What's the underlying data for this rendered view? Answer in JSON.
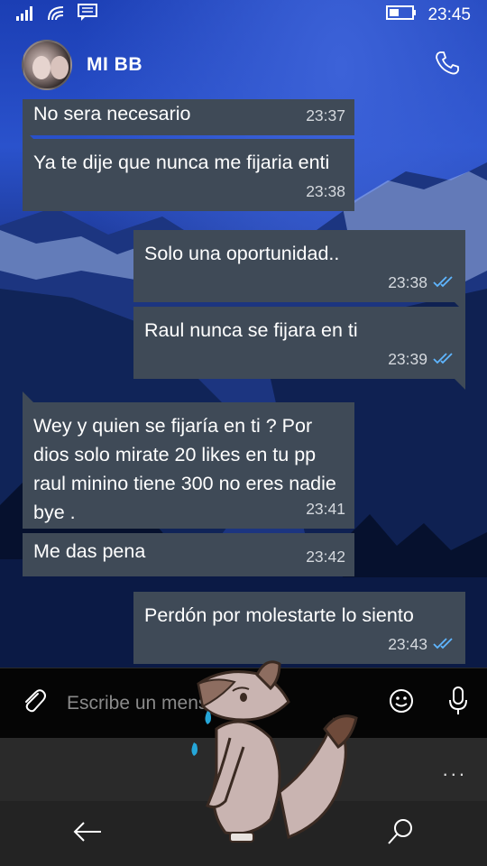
{
  "status_bar": {
    "time": "23:45",
    "icons": [
      "signal-icon",
      "wifi-icon",
      "message-notification-icon",
      "battery-icon"
    ]
  },
  "header": {
    "contact_name": "MI BB",
    "avatar": "avatar",
    "call_icon": "phone-icon"
  },
  "messages": [
    {
      "direction": "in",
      "text": "No sera necesario",
      "time": "23:37"
    },
    {
      "direction": "in",
      "text": "Ya te dije que nunca me fijaria enti",
      "time": "23:38"
    },
    {
      "direction": "out",
      "text": "Solo una oportunidad..",
      "time": "23:38",
      "read": true
    },
    {
      "direction": "out",
      "text": "Raul nunca se fijara en ti",
      "time": "23:39",
      "read": true
    },
    {
      "direction": "in",
      "text": "Wey y quien se fijaría en ti ? Por dios solo mirate 20 likes en tu pp raul minino tiene 300 no eres nadie bye .",
      "time": "23:41"
    },
    {
      "direction": "in",
      "text": "Me das pena",
      "time": "23:42"
    },
    {
      "direction": "out",
      "text": "Perdón por molestarte lo siento",
      "time": "23:43",
      "read": true
    }
  ],
  "input_bar": {
    "placeholder": "Escribe un mensaje",
    "icons": [
      "paperclip-icon",
      "emoji-icon",
      "microphone-icon"
    ]
  },
  "app_bar": {
    "more": "..."
  },
  "nav_bar": {
    "icons": [
      "back-arrow-icon",
      "search-icon"
    ]
  },
  "colors": {
    "bubble": "#3f4a57",
    "read_ticks": "#5fb6ff",
    "input_bg": "#050505",
    "appbar_bg": "#2a2a2a"
  }
}
